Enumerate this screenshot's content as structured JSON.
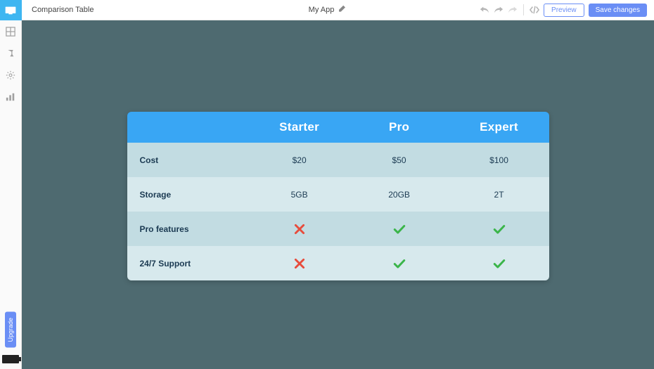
{
  "topbar": {
    "title": "Comparison Table",
    "app_name": "My App",
    "preview_label": "Preview",
    "save_label": "Save changes"
  },
  "sidebar": {
    "upgrade_label": "Upgrade"
  },
  "table": {
    "plans": [
      "Starter",
      "Pro",
      "Expert"
    ],
    "rows": [
      {
        "label": "Cost",
        "type": "text",
        "values": [
          "$20",
          "$50",
          "$100"
        ]
      },
      {
        "label": "Storage",
        "type": "text",
        "values": [
          "5GB",
          "20GB",
          "2T"
        ]
      },
      {
        "label": "Pro features",
        "type": "bool",
        "values": [
          false,
          true,
          true
        ]
      },
      {
        "label": "24/7 Support",
        "type": "bool",
        "values": [
          false,
          true,
          true
        ]
      }
    ]
  }
}
